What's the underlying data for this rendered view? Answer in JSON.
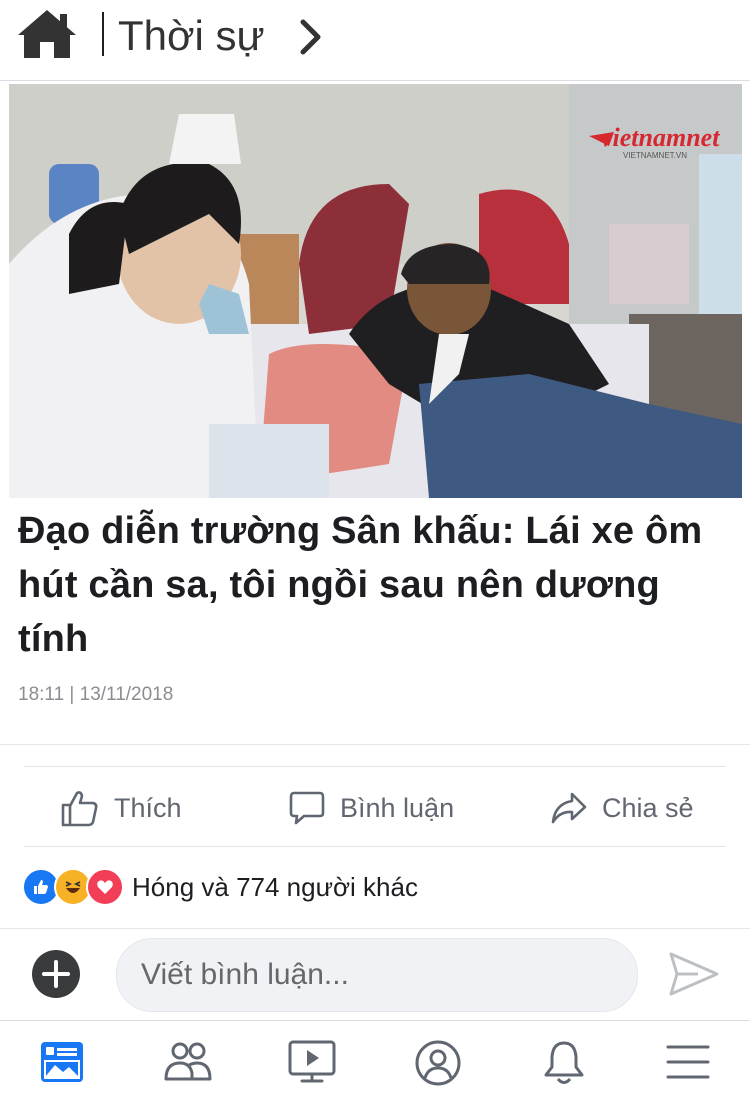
{
  "header": {
    "section_title": "Thời sự",
    "home_icon": "home-icon",
    "chevron_icon": "chevron-right-icon"
  },
  "article": {
    "image_logo_text": "vietnamnet",
    "image_logo_sub": "VIETNAMNET.VN",
    "headline": "Đạo diễn trường Sân khấu: Lái xe ôm hút cần sa, tôi ngồi sau nên dương tính",
    "meta": "18:11 | 13/11/2018"
  },
  "actions": {
    "like_label": "Thích",
    "comment_label": "Bình luận",
    "share_label": "Chia sẻ"
  },
  "reactions": {
    "summary": "Hóng và 774 người khác",
    "types": [
      "like",
      "haha",
      "love"
    ],
    "colors": {
      "like": "#1877f2",
      "haha": "#f7b125",
      "love": "#f33e58"
    }
  },
  "comment": {
    "placeholder": "Viết bình luận..."
  },
  "bottom_nav": {
    "items": [
      "news-feed-icon",
      "friends-icon",
      "watch-icon",
      "profile-icon",
      "notifications-icon",
      "menu-icon"
    ],
    "active_color": "#1877f2"
  }
}
